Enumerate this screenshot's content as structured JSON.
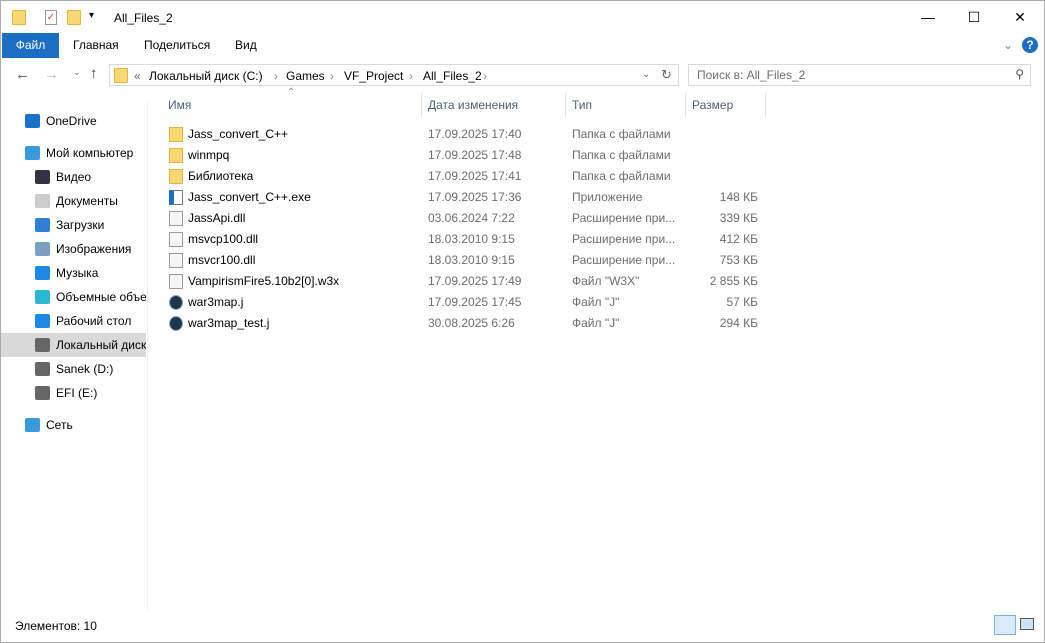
{
  "window": {
    "title": "All_Files_2",
    "minimize": "—",
    "maximize": "☐",
    "close": "✕"
  },
  "ribbon": {
    "tabs": [
      "Файл",
      "Главная",
      "Поделиться",
      "Вид"
    ],
    "help": "?"
  },
  "address": {
    "prefix": "«",
    "crumbs": [
      "Локальный диск (C:)",
      "Games",
      "VF_Project",
      "All_Files_2"
    ]
  },
  "search": {
    "placeholder": "Поиск в: All_Files_2"
  },
  "sidebar": [
    {
      "label": "OneDrive",
      "icon": "cloud-icon",
      "color": "#1a73c9",
      "indent": 0
    },
    {
      "label": "Мой компьютер",
      "icon": "computer-icon",
      "color": "#3a9ad9",
      "indent": 0
    },
    {
      "label": "Видео",
      "icon": "video-icon",
      "color": "#334",
      "indent": 1
    },
    {
      "label": "Документы",
      "icon": "document-icon",
      "color": "#ccc",
      "indent": 1
    },
    {
      "label": "Загрузки",
      "icon": "download-icon",
      "color": "#2f7fd6",
      "indent": 1
    },
    {
      "label": "Изображения",
      "icon": "image-icon",
      "color": "#7aa0c0",
      "indent": 1
    },
    {
      "label": "Музыка",
      "icon": "music-icon",
      "color": "#1e88e5",
      "indent": 1
    },
    {
      "label": "Объемные объе",
      "icon": "cube-icon",
      "color": "#2bb6d6",
      "indent": 1
    },
    {
      "label": "Рабочий стол",
      "icon": "desktop-icon",
      "color": "#1e88e5",
      "indent": 1
    },
    {
      "label": "Локальный диск",
      "icon": "drive-icon",
      "color": "#666",
      "indent": 1,
      "selected": true
    },
    {
      "label": "Sanek (D:)",
      "icon": "drive-icon",
      "color": "#666",
      "indent": 1
    },
    {
      "label": "EFI (E:)",
      "icon": "drive-icon",
      "color": "#666",
      "indent": 1
    },
    {
      "label": "Сеть",
      "icon": "network-icon",
      "color": "#3a9ad9",
      "indent": 0
    }
  ],
  "columns": {
    "name": "Имя",
    "date": "Дата изменения",
    "type": "Тип",
    "size": "Размер"
  },
  "files": [
    {
      "name": "Jass_convert_C++",
      "date": "17.09.2025 17:40",
      "type": "Папка с файлами",
      "size": "",
      "kind": "folder"
    },
    {
      "name": "winmpq",
      "date": "17.09.2025 17:48",
      "type": "Папка с файлами",
      "size": "",
      "kind": "folder"
    },
    {
      "name": "Библиотека",
      "date": "17.09.2025 17:41",
      "type": "Папка с файлами",
      "size": "",
      "kind": "folder"
    },
    {
      "name": "Jass_convert_C++.exe",
      "date": "17.09.2025 17:36",
      "type": "Приложение",
      "size": "148 КБ",
      "kind": "exe"
    },
    {
      "name": "JassApi.dll",
      "date": "03.06.2024 7:22",
      "type": "Расширение при...",
      "size": "339 КБ",
      "kind": "dll"
    },
    {
      "name": "msvcp100.dll",
      "date": "18.03.2010 9:15",
      "type": "Расширение при...",
      "size": "412 КБ",
      "kind": "dll"
    },
    {
      "name": "msvcr100.dll",
      "date": "18.03.2010 9:15",
      "type": "Расширение при...",
      "size": "753 КБ",
      "kind": "dll"
    },
    {
      "name": "VampirismFire5.10b2[0].w3x",
      "date": "17.09.2025 17:49",
      "type": "Файл \"W3X\"",
      "size": "2 855 КБ",
      "kind": "file"
    },
    {
      "name": "war3map.j",
      "date": "17.09.2025 17:45",
      "type": "Файл \"J\"",
      "size": "57 КБ",
      "kind": "j"
    },
    {
      "name": "war3map_test.j",
      "date": "30.08.2025 6:26",
      "type": "Файл \"J\"",
      "size": "294 КБ",
      "kind": "j"
    }
  ],
  "status": {
    "count": "Элементов: 10"
  }
}
